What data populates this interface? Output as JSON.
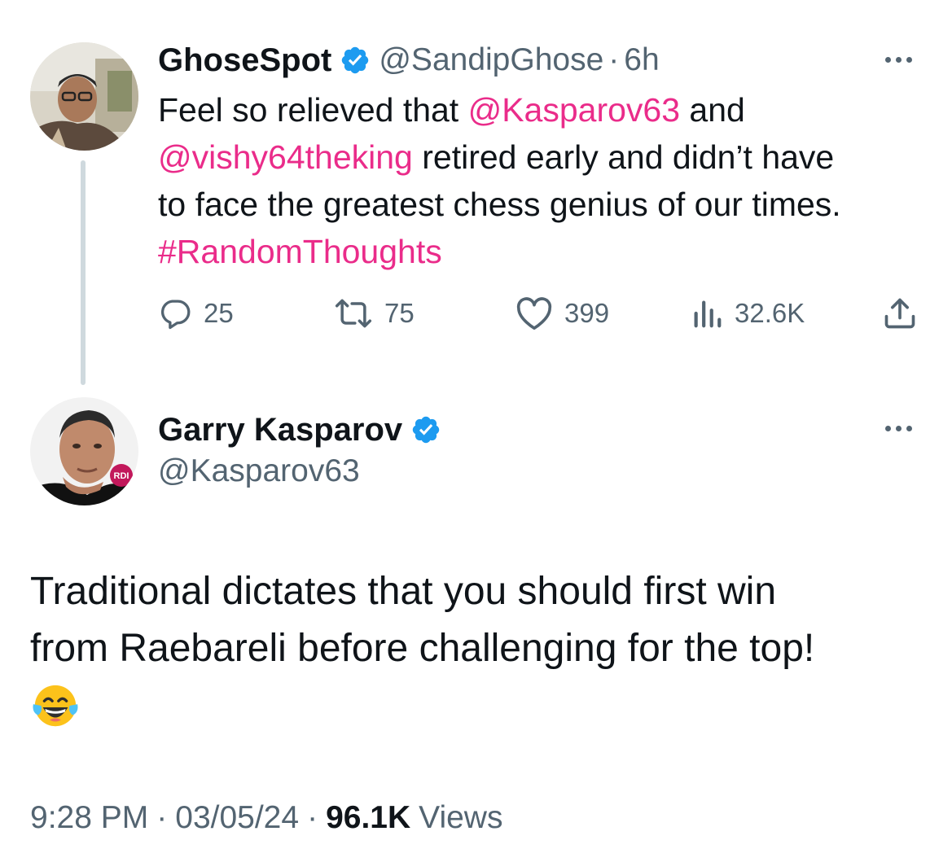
{
  "parent_tweet": {
    "display_name": "GhoseSpot",
    "handle": "@SandipGhose",
    "separator": "·",
    "age": "6h",
    "text_lines": [
      [
        {
          "t": "Feel so relieved that ",
          "c": "plain"
        },
        {
          "t": "@Kasparov63",
          "c": "link"
        },
        {
          "t": " and",
          "c": "plain"
        }
      ],
      [
        {
          "t": "@vishy64theking",
          "c": "link"
        },
        {
          "t": " retired early and didn’t have",
          "c": "plain"
        }
      ],
      [
        {
          "t": "to face the greatest chess genius of our times.",
          "c": "plain"
        }
      ],
      [
        {
          "t": "#RandomThoughts",
          "c": "link"
        }
      ]
    ],
    "actions": {
      "replies": "25",
      "reposts": "75",
      "likes": "399",
      "views": "32.6K"
    }
  },
  "reply_tweet": {
    "display_name": "Garry Kasparov",
    "handle": "@Kasparov63",
    "avatar_badge": "RDI",
    "text_lines": [
      "Traditional dictates that you should first win",
      "from Raebareli before challenging for the top!"
    ],
    "emoji": "face-with-tears-of-joy"
  },
  "footer": {
    "time": "9:28 PM",
    "separator": "·",
    "date": "03/05/24",
    "views_count": "96.1K",
    "views_label": "Views"
  },
  "colors": {
    "text": "#0f1419",
    "muted": "#536471",
    "link": "#ea2c8a",
    "verified": "#1d9bf0",
    "thread_line": "#cfd9de"
  }
}
